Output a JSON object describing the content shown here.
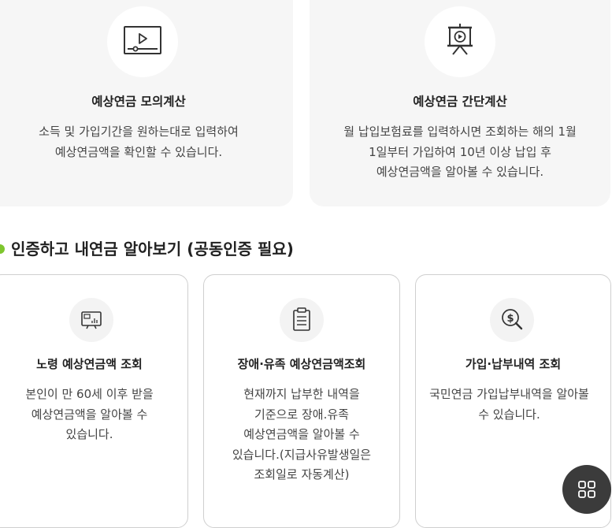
{
  "top_cards": [
    {
      "title": "예상연금 모의계산",
      "desc_lines": [
        "소득 및 가입기간을 원하는대로 입력하여",
        "예상연금액을 확인할 수 있습니다."
      ],
      "icon": "video-player-icon"
    },
    {
      "title": "예상연금 간단계산",
      "desc_lines": [
        "월 납입보험료를 입력하시면 조회하는 해의 1월",
        "1일부터 가입하여 10년 이상 납입 후",
        "예상연금액을 알아볼 수 있습니다."
      ],
      "icon": "presentation-board-icon"
    }
  ],
  "section": {
    "title": "인증하고 내연금 알아보기 (공동인증 필요)"
  },
  "bottom_cards": [
    {
      "title": "노령 예상연금액 조회",
      "desc_lines": [
        "본인이 만 60세 이후 받을",
        "예상연금액을 알아볼 수",
        "있습니다."
      ],
      "icon": "monitor-chart-icon"
    },
    {
      "title": "장애·유족 예상연금액조회",
      "desc_lines": [
        "현재까지 납부한 내역을",
        "기준으로 장애.유족",
        "예상연금액을 알아볼 수",
        "있습니다.(지급사유발생일은",
        "조회일로 자동계산)"
      ],
      "icon": "clipboard-icon"
    },
    {
      "title": "가입·납부내역 조회",
      "desc_lines": [
        "국민연금 가입납부내역을 알아볼",
        "수 있습니다."
      ],
      "icon": "dollar-search-icon"
    }
  ],
  "fab": {
    "icon": "grid-menu-icon"
  },
  "colors": {
    "accent": "#7ec62e",
    "card_bg": "#f6f6f6",
    "fab_bg": "#3b3b3b"
  }
}
